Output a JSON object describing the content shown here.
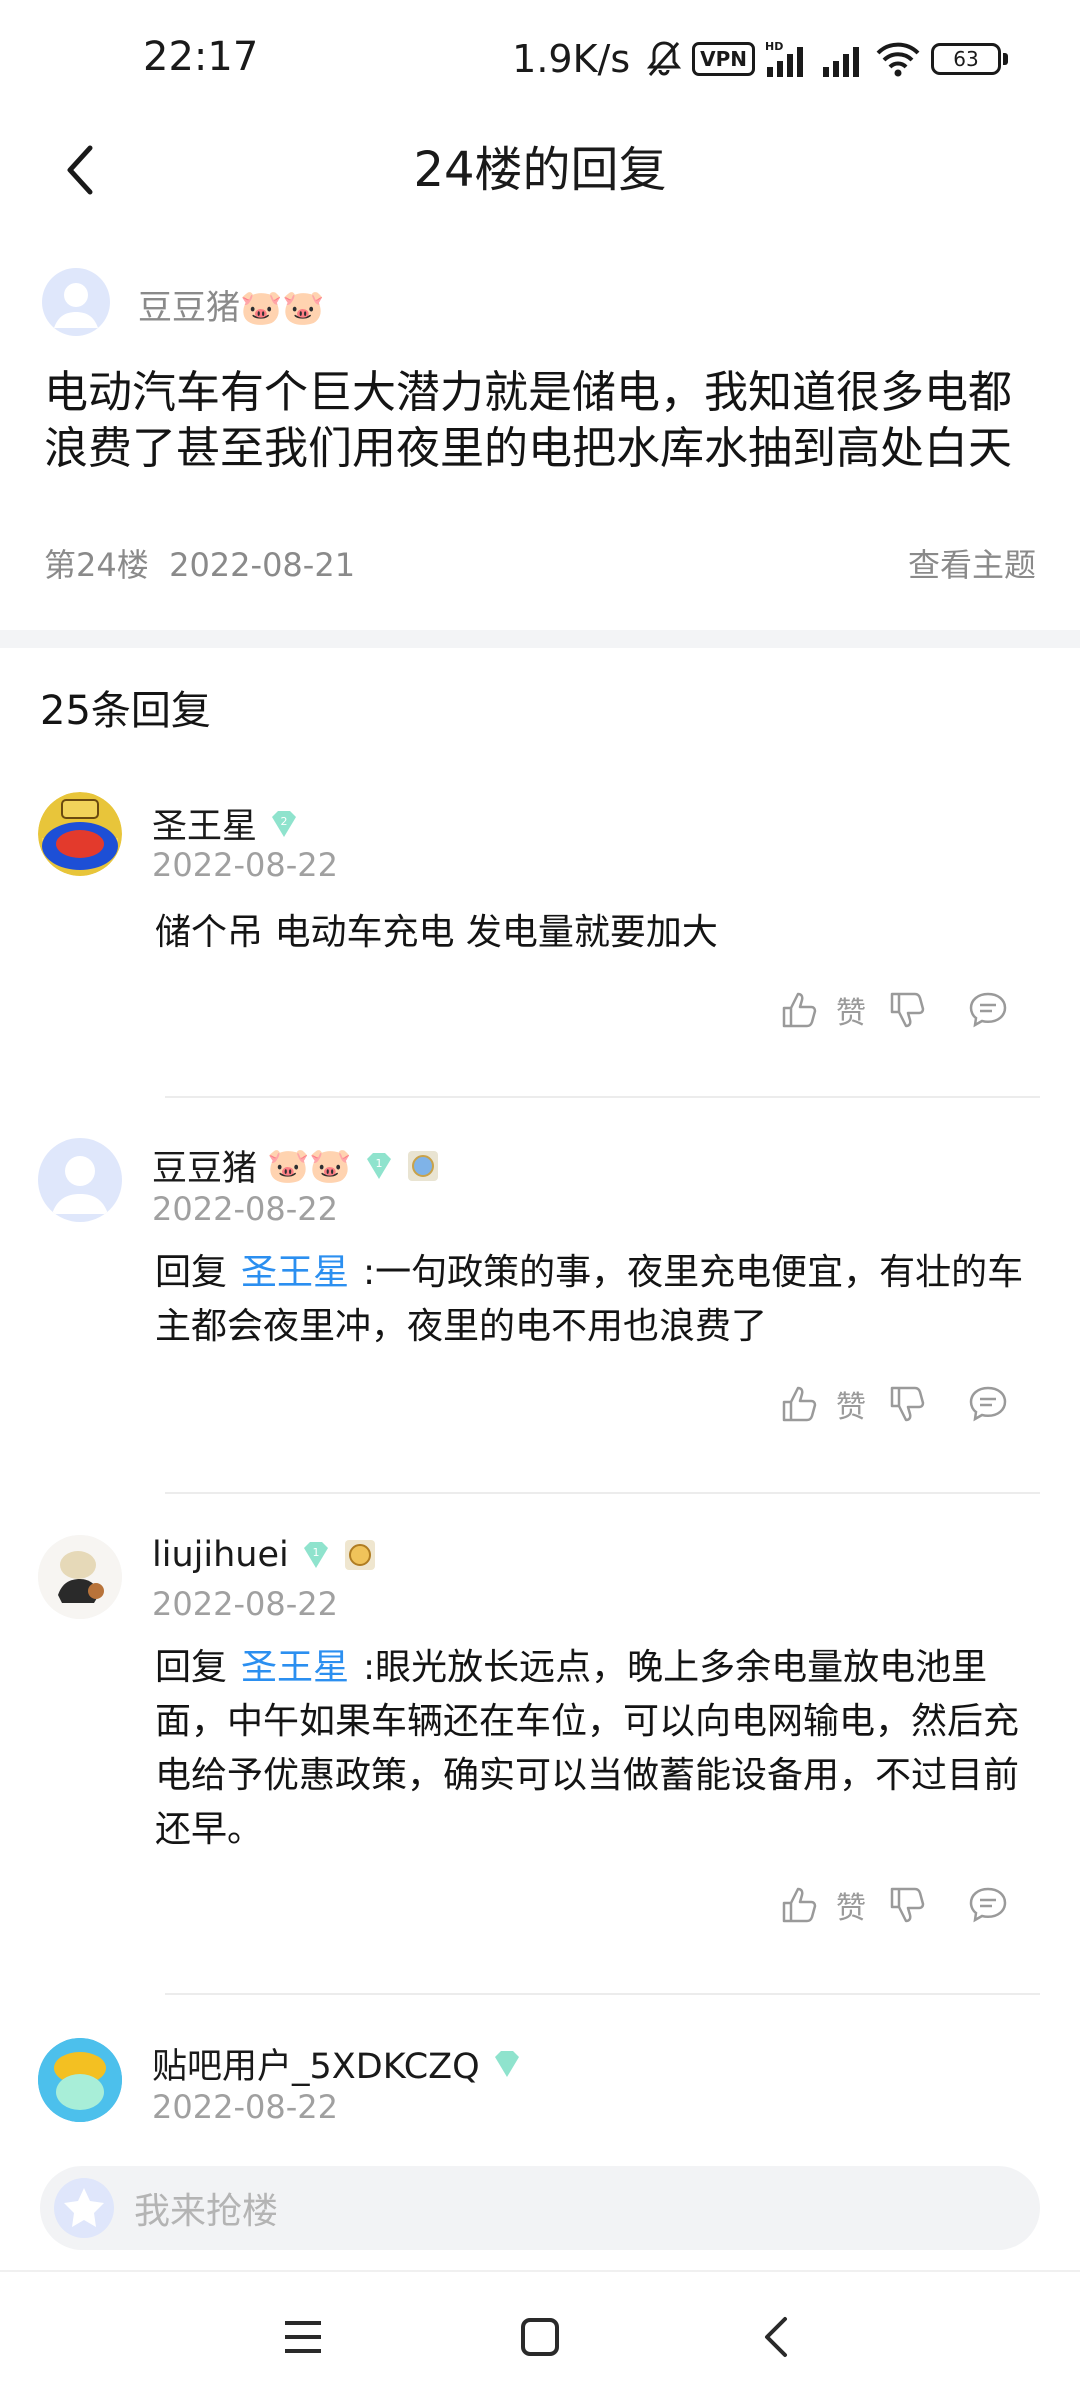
{
  "status_bar": {
    "time": "22:17",
    "speed": "1.9K/s",
    "vpn": "VPN",
    "battery": "63"
  },
  "header": {
    "title": "24楼的回复"
  },
  "original_post": {
    "author": "豆豆猪",
    "author_emoji": "🐷🐷",
    "text": "电动汽车有个巨大潜力就是储电，我知道很多电都浪费了甚至我们用夜里的电把水库水抽到高处白天",
    "floor": "第24楼",
    "date": "2022-08-21",
    "view_topic": "查看主题"
  },
  "replies_count": "25条回复",
  "replies": [
    {
      "name": "圣王星",
      "level": "2",
      "date": "2022-08-22",
      "text": "储个吊 电动车充电 发电量就要加大",
      "like_label": "赞"
    },
    {
      "name": "豆豆猪",
      "name_emoji": "🐷🐷",
      "level": "1",
      "date": "2022-08-22",
      "reply_prefix": "回复",
      "reply_to": "圣王星",
      "text": ":一句政策的事，夜里充电便宜，有壮的车主都会夜里冲，夜里的电不用也浪费了",
      "like_label": "赞"
    },
    {
      "name": "liujihuei",
      "level": "1",
      "date": "2022-08-22",
      "reply_prefix": "回复",
      "reply_to": "圣王星",
      "text": ":眼光放长远点，晚上多余电量放电池里面，中午如果车辆还在车位，可以向电网输电，然后充电给予优惠政策，确实可以当做蓄能设备用，不过目前还早。",
      "like_label": "赞"
    },
    {
      "name": "贴吧用户_5XDKCZQ",
      "date": "2022-08-22"
    }
  ],
  "input": {
    "placeholder": "我来抢楼"
  },
  "colors": {
    "link": "#2b8ff0",
    "muted": "#8a8a8a",
    "badge": "#7fe0c4"
  }
}
